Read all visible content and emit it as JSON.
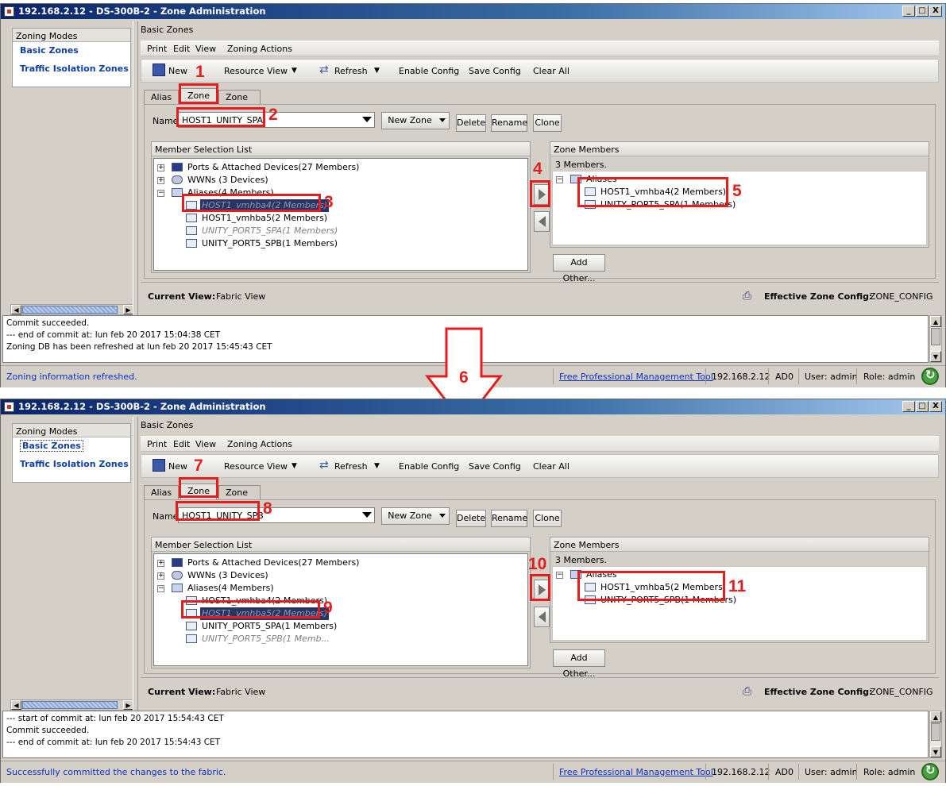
{
  "window_title": "192.168.2.12 - DS-300B-2 - Zone Administration",
  "window_controls": [
    "_",
    "□",
    "X"
  ],
  "zoning_modes": {
    "header": "Zoning Modes",
    "items": [
      "Basic Zones",
      "Traffic Isolation Zones"
    ]
  },
  "basic_zones_header": "Basic Zones",
  "menu": [
    "Print",
    "Edit",
    "View",
    "Zoning Actions"
  ],
  "toolbar": {
    "new": "New",
    "resource_view": "Resource View",
    "refresh": "Refresh",
    "enable_config": "Enable Config",
    "save_config": "Save Config",
    "clear_all": "Clear All"
  },
  "tabs": [
    "Alias",
    "Zone",
    "Zone Config"
  ],
  "name_label": "Name",
  "buttons": {
    "new_zone": "New Zone",
    "delete": "Delete",
    "rename": "Rename",
    "clone": "Clone",
    "add_other": "Add Other..."
  },
  "member_selection_header": "Member Selection List",
  "zone_members_header": "Zone Members",
  "zone_members_count": "3 Members.",
  "current_view_label": "Current View:",
  "current_view_value": "Fabric View",
  "effective_label": "Effective Zone Config:",
  "effective_value": "ZONE_CONFIG",
  "panels": [
    {
      "zone_name": "HOST1_UNITY_SPA",
      "tree": {
        "ports": "Ports & Attached Devices(27 Members)",
        "wwns": "WWNs (3 Devices)",
        "aliases": "Aliases(4 Members)",
        "alias_items": [
          "HOST1_vmhba4(2 Members)",
          "HOST1_vmhba5(2 Members)",
          "UNITY_PORT5_SPA(1 Members)",
          "UNITY_PORT5_SPB(1 Members)"
        ]
      },
      "members": {
        "folder": "Aliases",
        "items": [
          "HOST1_vmhba4(2 Members)",
          "UNITY_PORT5_SPA(1 Members)"
        ]
      },
      "log": [
        "Commit succeeded.",
        "--- end of commit at: lun feb 20 2017 15:04:38 CET",
        "Zoning DB has been refreshed at lun feb 20 2017 15:45:43 CET"
      ],
      "status_message": "Zoning information refreshed.",
      "numbers": [
        "1",
        "2",
        "3",
        "4",
        "5"
      ]
    },
    {
      "zone_name": "HOST1_UNITY_SPB",
      "tree": {
        "ports": "Ports & Attached Devices(27 Members)",
        "wwns": "WWNs (3 Devices)",
        "aliases": "Aliases(4 Members)",
        "alias_items": [
          "HOST1_vmhba4(2 Members)",
          "HOST1_vmhba5(2 Members)",
          "UNITY_PORT5_SPA(1 Members)",
          "UNITY_PORT5_SPB(1 Memb..."
        ]
      },
      "members": {
        "folder": "Aliases",
        "items": [
          "HOST1_vmhba5(2 Members)",
          "UNITY_PORT5_SPB(1 Members)"
        ]
      },
      "log": [
        "--- start of commit at: lun feb 20 2017 15:54:43 CET",
        "Commit succeeded.",
        "--- end of commit at: lun feb 20 2017 15:54:43 CET"
      ],
      "status_message": "Successfully committed the changes to the fabric.",
      "numbers": [
        "7",
        "8",
        "9",
        "10",
        "11"
      ]
    }
  ],
  "status": {
    "link": "Free Professional Management Tool",
    "ip": "192.168.2.12",
    "ad": "AD0",
    "user": "User: admin",
    "role": "Role: admin"
  },
  "step_six": "6",
  "colors": {
    "annotation": "#e41e1e",
    "link": "#1030c0",
    "title_bar": "#0a246a"
  }
}
